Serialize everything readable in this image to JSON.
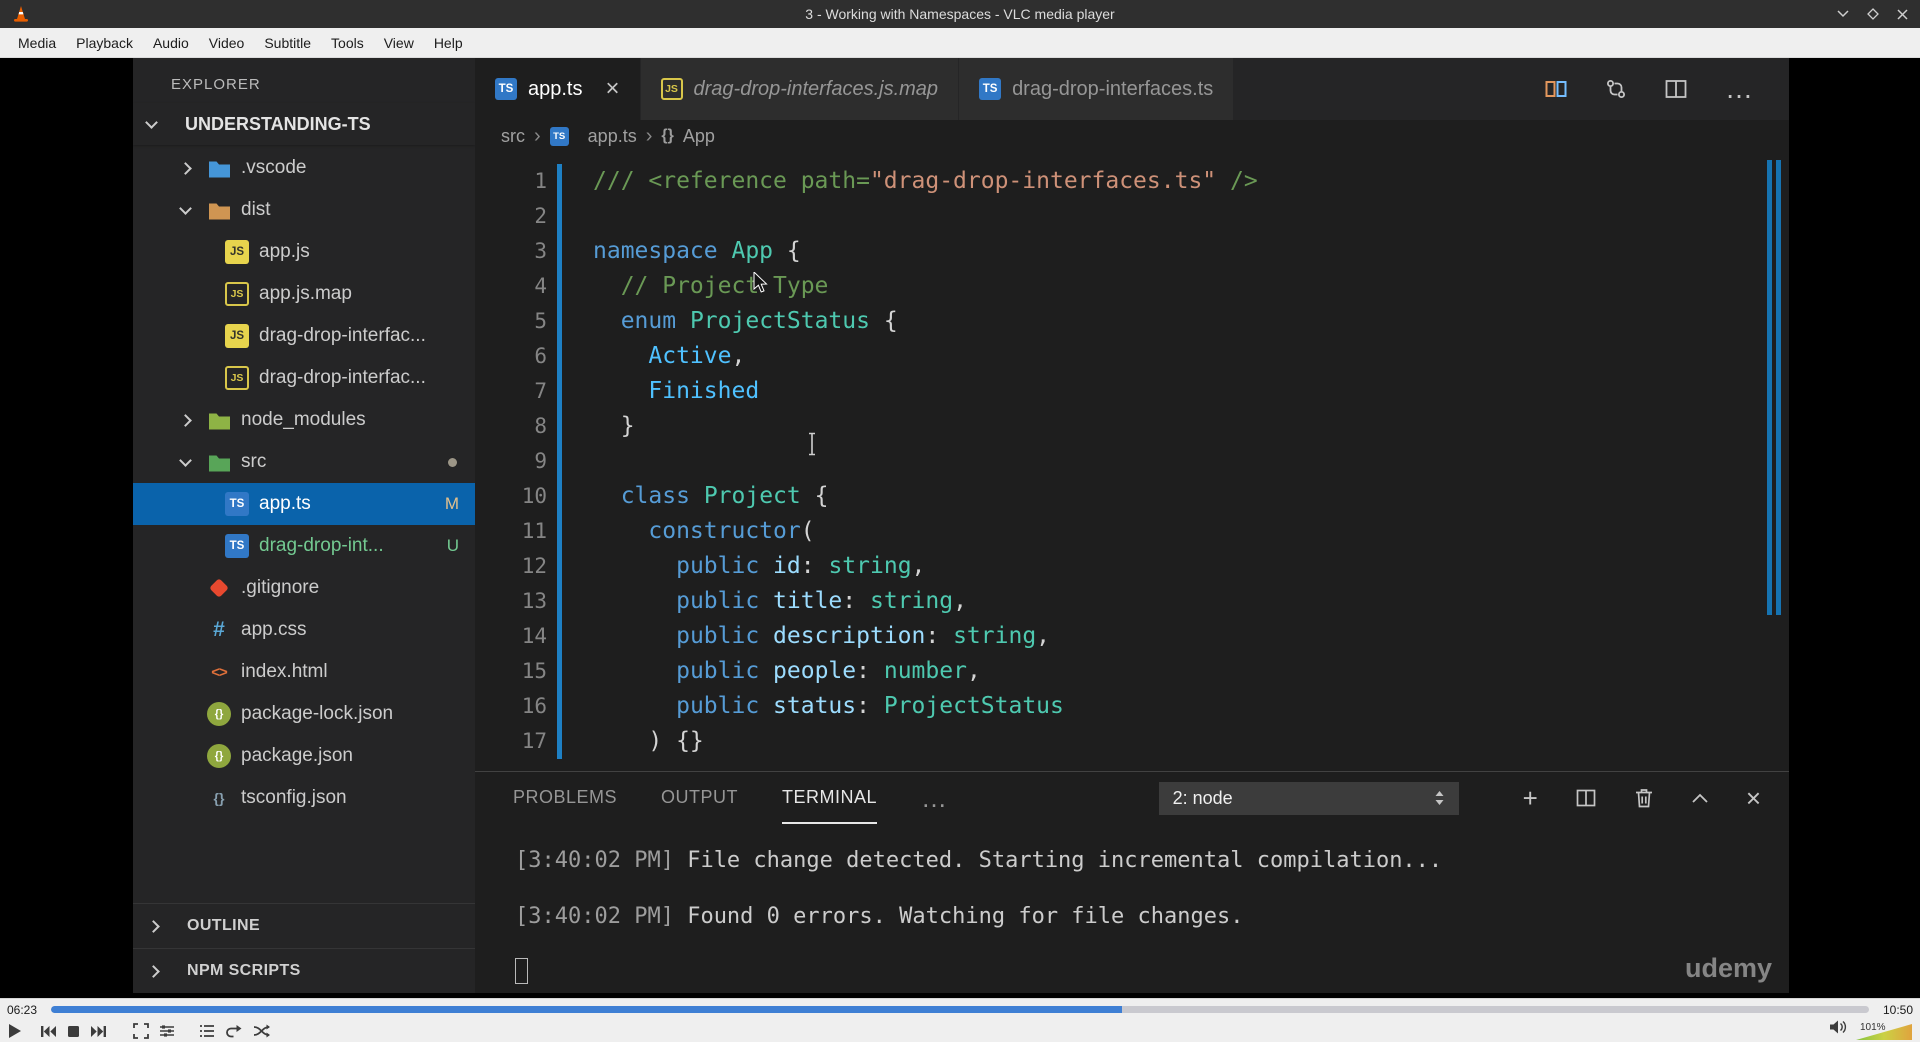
{
  "colors": {
    "selection_blue": "#0a63ab",
    "modified_badge": "#e2c08d",
    "untracked_green": "#73c991",
    "seek_progress_blue": "#3e7fd4",
    "tokens": {
      "c": "#6a9955",
      "s": "#ce9178",
      "k": "#569cd6",
      "t": "#4ec9b0",
      "v": "#9cdcfe",
      "e": "#4fc1ff",
      "n": "#d4d4d4"
    }
  },
  "vlc": {
    "window_title": "3 - Working with Namespaces - VLC media player",
    "menu": [
      "Media",
      "Playback",
      "Audio",
      "Video",
      "Subtitle",
      "Tools",
      "View",
      "Help"
    ],
    "time_elapsed": "06:23",
    "time_total": "10:50",
    "progress_percent": 58.9,
    "volume_label": "101%"
  },
  "vscode": {
    "explorer": {
      "header": "EXPLORER",
      "project": "UNDERSTANDING-TS",
      "tree": [
        {
          "label": ".vscode",
          "icon": "folder-vscode",
          "depth": 0,
          "chevron": "right"
        },
        {
          "label": "dist",
          "icon": "folder-dist",
          "depth": 0,
          "chevron": "down"
        },
        {
          "label": "app.js",
          "icon": "js",
          "depth": 1
        },
        {
          "label": "app.js.map",
          "icon": "jsmap",
          "depth": 1
        },
        {
          "label": "drag-drop-interfac...",
          "icon": "js",
          "depth": 1
        },
        {
          "label": "drag-drop-interfac...",
          "icon": "jsmap",
          "depth": 1
        },
        {
          "label": "node_modules",
          "icon": "folder-node",
          "depth": 0,
          "chevron": "right"
        },
        {
          "label": "src",
          "icon": "folder-src",
          "depth": 0,
          "chevron": "down",
          "dot": true
        },
        {
          "label": "app.ts",
          "icon": "ts",
          "depth": 1,
          "selected": true,
          "badge": "M"
        },
        {
          "label": "drag-drop-int...",
          "icon": "ts",
          "depth": 1,
          "badge": "U",
          "untracked": true
        },
        {
          "label": ".gitignore",
          "icon": "git",
          "depth": 0
        },
        {
          "label": "app.css",
          "icon": "css",
          "depth": 0
        },
        {
          "label": "index.html",
          "icon": "html",
          "depth": 0
        },
        {
          "label": "package-lock.json",
          "icon": "json",
          "depth": 0
        },
        {
          "label": "package.json",
          "icon": "json",
          "depth": 0
        },
        {
          "label": "tsconfig.json",
          "icon": "tsjson",
          "depth": 0
        }
      ],
      "sections": [
        {
          "label": "OUTLINE"
        },
        {
          "label": "NPM SCRIPTS"
        }
      ]
    },
    "tabs": [
      {
        "label": "app.ts",
        "icon": "ts",
        "active": true
      },
      {
        "label": "drag-drop-interfaces.js.map",
        "icon": "jsmap",
        "italic": true
      },
      {
        "label": "drag-drop-interfaces.ts",
        "icon": "ts"
      }
    ],
    "breadcrumb": [
      "src",
      "app.ts",
      "App"
    ],
    "editor": {
      "lines": [
        {
          "n": 1,
          "tokens": [
            [
              "c",
              "/// <reference path="
            ],
            [
              "s",
              "\"drag-drop-interfaces.ts\""
            ],
            [
              "c",
              " />"
            ]
          ]
        },
        {
          "n": 2,
          "tokens": []
        },
        {
          "n": 3,
          "tokens": [
            [
              "k",
              "namespace"
            ],
            [
              "n",
              " "
            ],
            [
              "t",
              "App"
            ],
            [
              "n",
              " {"
            ]
          ]
        },
        {
          "n": 4,
          "tokens": [
            [
              "c",
              "  // Project Type"
            ]
          ]
        },
        {
          "n": 5,
          "tokens": [
            [
              "n",
              "  "
            ],
            [
              "k",
              "enum"
            ],
            [
              "n",
              " "
            ],
            [
              "t",
              "ProjectStatus"
            ],
            [
              "n",
              " {"
            ]
          ]
        },
        {
          "n": 6,
          "tokens": [
            [
              "n",
              "    "
            ],
            [
              "e",
              "Active"
            ],
            [
              "n",
              ","
            ]
          ]
        },
        {
          "n": 7,
          "tokens": [
            [
              "n",
              "    "
            ],
            [
              "e",
              "Finished"
            ]
          ]
        },
        {
          "n": 8,
          "tokens": [
            [
              "n",
              "  }"
            ]
          ]
        },
        {
          "n": 9,
          "tokens": []
        },
        {
          "n": 10,
          "tokens": [
            [
              "n",
              "  "
            ],
            [
              "k",
              "class"
            ],
            [
              "n",
              " "
            ],
            [
              "t",
              "Project"
            ],
            [
              "n",
              " {"
            ]
          ]
        },
        {
          "n": 11,
          "tokens": [
            [
              "n",
              "    "
            ],
            [
              "k",
              "constructor"
            ],
            [
              "n",
              "("
            ]
          ]
        },
        {
          "n": 12,
          "tokens": [
            [
              "n",
              "      "
            ],
            [
              "k",
              "public"
            ],
            [
              "n",
              " "
            ],
            [
              "v",
              "id"
            ],
            [
              "n",
              ": "
            ],
            [
              "t",
              "string"
            ],
            [
              "n",
              ","
            ]
          ]
        },
        {
          "n": 13,
          "tokens": [
            [
              "n",
              "      "
            ],
            [
              "k",
              "public"
            ],
            [
              "n",
              " "
            ],
            [
              "v",
              "title"
            ],
            [
              "n",
              ": "
            ],
            [
              "t",
              "string"
            ],
            [
              "n",
              ","
            ]
          ]
        },
        {
          "n": 14,
          "tokens": [
            [
              "n",
              "      "
            ],
            [
              "k",
              "public"
            ],
            [
              "n",
              " "
            ],
            [
              "v",
              "description"
            ],
            [
              "n",
              ": "
            ],
            [
              "t",
              "string"
            ],
            [
              "n",
              ","
            ]
          ]
        },
        {
          "n": 15,
          "tokens": [
            [
              "n",
              "      "
            ],
            [
              "k",
              "public"
            ],
            [
              "n",
              " "
            ],
            [
              "v",
              "people"
            ],
            [
              "n",
              ": "
            ],
            [
              "t",
              "number"
            ],
            [
              "n",
              ","
            ]
          ]
        },
        {
          "n": 16,
          "tokens": [
            [
              "n",
              "      "
            ],
            [
              "k",
              "public"
            ],
            [
              "n",
              " "
            ],
            [
              "v",
              "status"
            ],
            [
              "n",
              ": "
            ],
            [
              "t",
              "ProjectStatus"
            ]
          ]
        },
        {
          "n": 17,
          "tokens": [
            [
              "n",
              "    ) {}"
            ]
          ]
        }
      ]
    },
    "panel": {
      "tabs": [
        "PROBLEMS",
        "OUTPUT",
        "TERMINAL"
      ],
      "active_tab": "TERMINAL",
      "shell_selector": "2: node",
      "output": [
        {
          "time": "[3:40:02 PM]",
          "text": "File change detected. Starting incremental compilation..."
        },
        {
          "time": "[3:40:02 PM]",
          "text": "Found 0 errors. Watching for file changes."
        }
      ]
    },
    "watermark": "udemy"
  }
}
